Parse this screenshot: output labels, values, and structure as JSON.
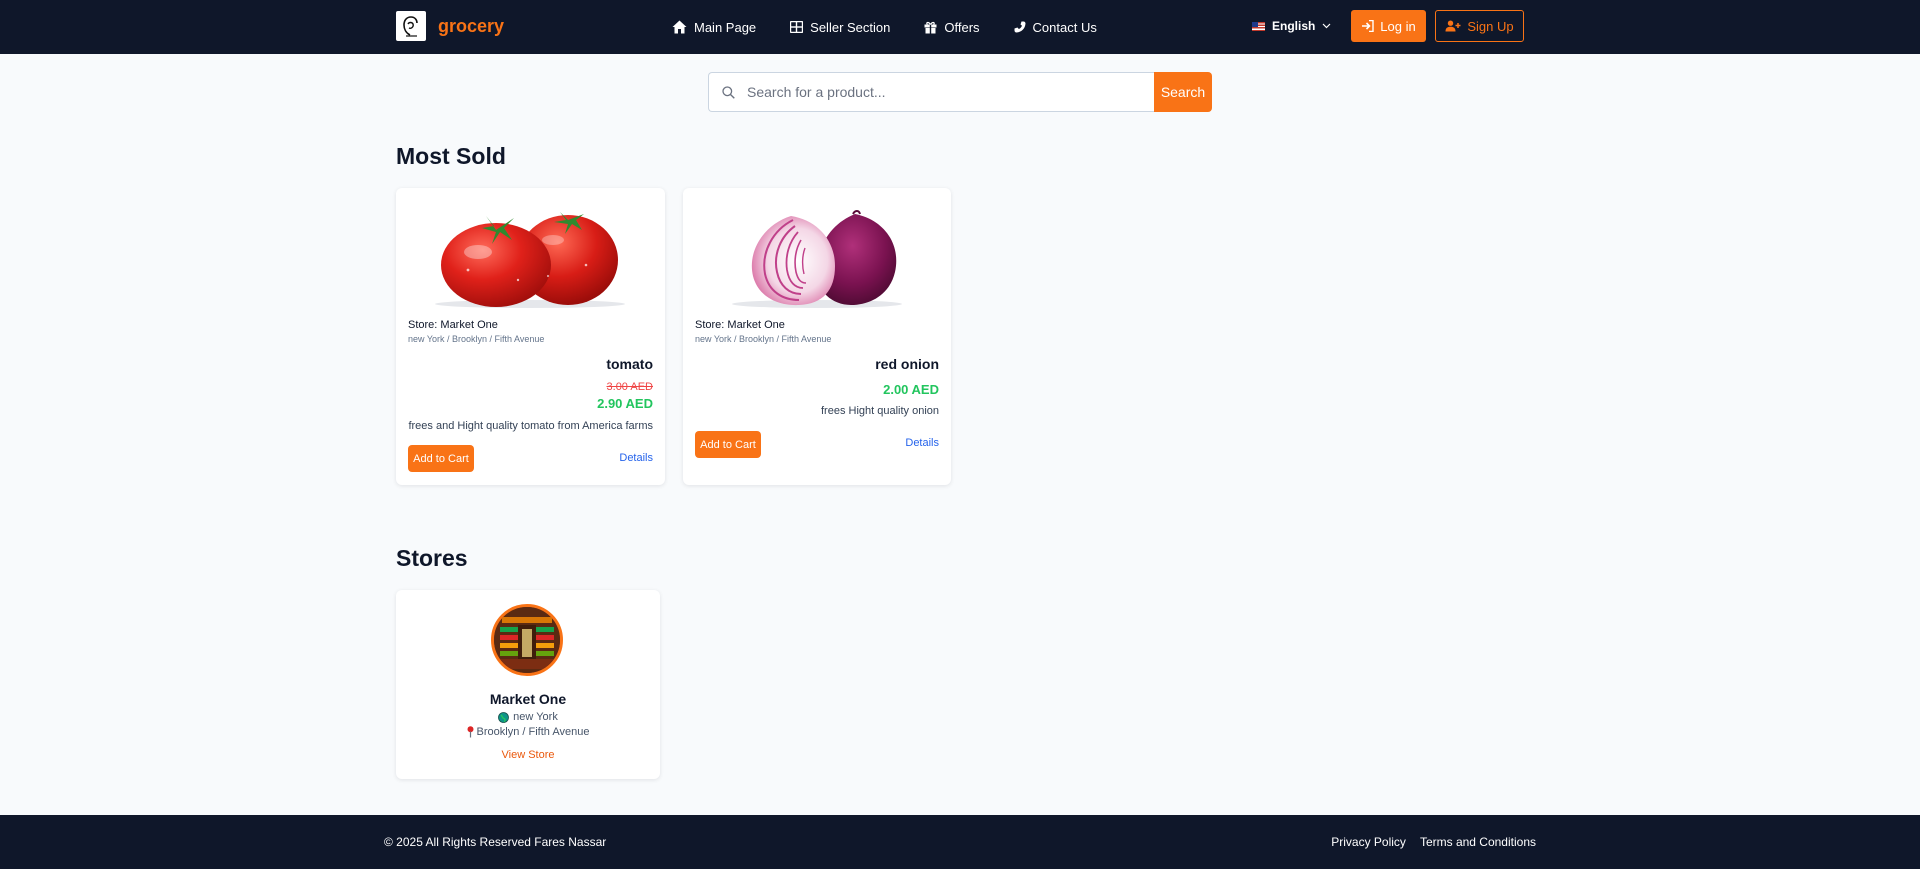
{
  "header": {
    "brand": "grocery",
    "nav": [
      {
        "label": "Main Page",
        "icon": "home-icon"
      },
      {
        "label": "Seller Section",
        "icon": "grid-icon"
      },
      {
        "label": "Offers",
        "icon": "gift-icon"
      },
      {
        "label": "Contact Us",
        "icon": "phone-icon"
      }
    ],
    "language": "English",
    "login_label": "Log in",
    "signup_label": "Sign Up"
  },
  "search": {
    "placeholder": "Search for a product...",
    "button_label": "Search"
  },
  "most_sold": {
    "title": "Most Sold",
    "products": [
      {
        "store": "Store: Market One",
        "location": "new York / Brooklyn / Fifth Avenue",
        "name": "tomato",
        "old_price": "3.00 AED",
        "price": "2.90 AED",
        "description": "frees and Hight quality tomato from America farms",
        "add_label": "Add to Cart",
        "details_label": "Details"
      },
      {
        "store": "Store: Market One",
        "location": "new York / Brooklyn / Fifth Avenue",
        "name": "red onion",
        "price": "2.00 AED",
        "description": "frees Hight quality onion",
        "add_label": "Add to Cart",
        "details_label": "Details"
      }
    ]
  },
  "stores": {
    "title": "Stores",
    "items": [
      {
        "name": "Market One",
        "city": "new York",
        "address": "Brooklyn / Fifth Avenue",
        "view_label": "View Store"
      }
    ]
  },
  "footer": {
    "copyright": "© 2025 All Rights Reserved Fares Nassar",
    "links": [
      "Privacy Policy",
      "Terms and Conditions"
    ]
  },
  "colors": {
    "header_bg": "#0f172a",
    "accent": "#f97316",
    "price_green": "#22c55e",
    "old_price_red": "#ef4444",
    "link_blue": "#2563eb"
  }
}
